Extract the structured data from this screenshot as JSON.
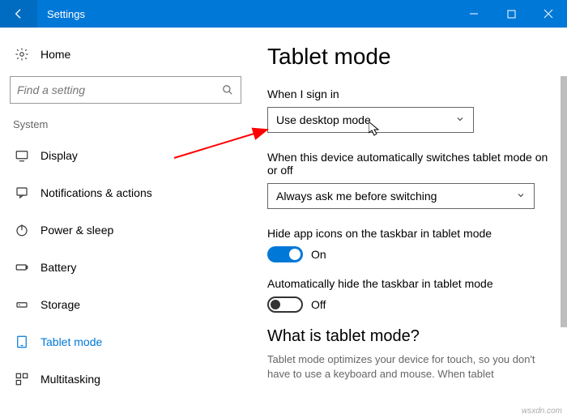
{
  "window": {
    "title": "Settings"
  },
  "sidebar": {
    "home": "Home",
    "search_placeholder": "Find a setting",
    "category": "System",
    "items": [
      {
        "label": "Display",
        "icon": "display-icon"
      },
      {
        "label": "Notifications & actions",
        "icon": "notifications-icon"
      },
      {
        "label": "Power & sleep",
        "icon": "power-icon"
      },
      {
        "label": "Battery",
        "icon": "battery-icon"
      },
      {
        "label": "Storage",
        "icon": "storage-icon"
      },
      {
        "label": "Tablet mode",
        "icon": "tablet-icon",
        "selected": true
      },
      {
        "label": "Multitasking",
        "icon": "multitasking-icon"
      }
    ]
  },
  "main": {
    "title": "Tablet mode",
    "signin_label": "When I sign in",
    "signin_value": "Use desktop mode",
    "auto_label": "When this device automatically switches tablet mode on or off",
    "auto_value": "Always ask me before switching",
    "hide_icons_label": "Hide app icons on the taskbar in tablet mode",
    "hide_icons_state": "On",
    "auto_hide_label": "Automatically hide the taskbar in tablet mode",
    "auto_hide_state": "Off",
    "what_title": "What is tablet mode?",
    "what_desc": "Tablet mode optimizes your device for touch, so you don't have to use a keyboard and mouse. When tablet"
  },
  "watermark": "wsxdn.com"
}
